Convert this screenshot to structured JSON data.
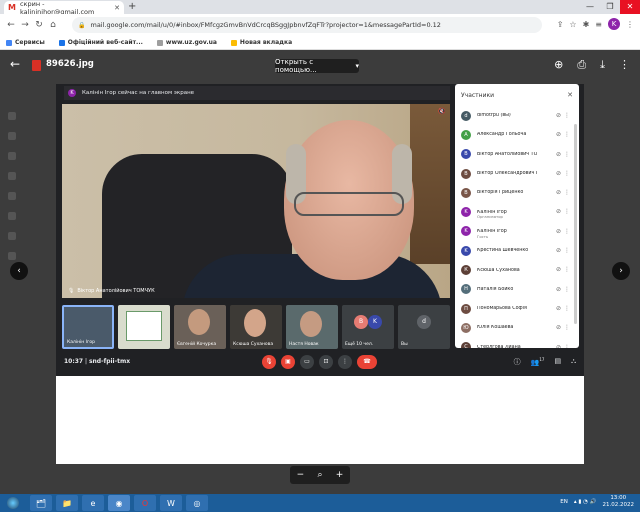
{
  "browser": {
    "tab_title": "скрин - kalininihor@gmail.com",
    "address": "mail.google.com/mail/u/0/#inbox/FMfcgzGmvBnVdCrcqBSggJpbnvfZqFTr?projector=1&messagePartId=0.12",
    "bookmarks": [
      "Сервисы",
      "Офіційний веб-сайт...",
      "www.uz.gov.ua",
      "Новая вкладка"
    ],
    "profile_initial": "K"
  },
  "viewer": {
    "file_name": "89626.jpg",
    "open_with": "Открыть с помощью..."
  },
  "meet": {
    "banner": "Калінін Ігор сейчас на главном экране",
    "banner_initial": "K",
    "main_speaker": "Віктор Анатолійович ТОМЧУК",
    "thumbs": [
      {
        "label": "Калінін Ігор"
      },
      {
        "label": ""
      },
      {
        "label": "Євгеній Кочурка"
      },
      {
        "label": "Ксюша Суханова"
      },
      {
        "label": "Настя Новак"
      },
      {
        "label": "Ещё 10 чел.",
        "initials": [
          "B",
          "K"
        ]
      },
      {
        "label": "Вы",
        "initials": [
          "d"
        ]
      }
    ],
    "time": "10:37",
    "meeting_code": "snd-fpii-tmx",
    "participants_badge": "17"
  },
  "participants": {
    "title": "Участники",
    "list": [
      {
        "name": "dimotrpu (вы)",
        "initial": "d",
        "color": "#455a64",
        "sub": ""
      },
      {
        "name": "Александр Гольоча",
        "initial": "A",
        "color": "#43a047",
        "sub": ""
      },
      {
        "name": "Віктор Анатолійович ТО...",
        "initial": "B",
        "color": "#3949ab",
        "sub": ""
      },
      {
        "name": "Віктор Олександрович Г...",
        "initial": "В",
        "color": "#6d4c41",
        "sub": ""
      },
      {
        "name": "Вікторія Гриценко",
        "initial": "В",
        "color": "#795548",
        "sub": ""
      },
      {
        "name": "Калінін Ігор",
        "initial": "K",
        "color": "#8e24aa",
        "sub": "Организатор"
      },
      {
        "name": "Калінін Ігор",
        "initial": "K",
        "color": "#8e24aa",
        "sub": "Гость"
      },
      {
        "name": "Крестина Шевченко",
        "initial": "K",
        "color": "#3949ab",
        "sub": ""
      },
      {
        "name": "Ксюша Суханова",
        "initial": "К",
        "color": "#5d4037",
        "sub": ""
      },
      {
        "name": "Наталія Бойко",
        "initial": "Н",
        "color": "#546e7a",
        "sub": ""
      },
      {
        "name": "Пономарьова Софія",
        "initial": "П",
        "color": "#6d4c41",
        "sub": ""
      },
      {
        "name": "Юлія Кошаева",
        "initial": "Ю",
        "color": "#8d6e63",
        "sub": ""
      },
      {
        "name": "Стерлгова Лиана",
        "initial": "С",
        "color": "#5d4037",
        "sub": ""
      }
    ]
  },
  "taskbar": {
    "lang": "EN",
    "time": "13:00",
    "date": "21.02.2022"
  }
}
